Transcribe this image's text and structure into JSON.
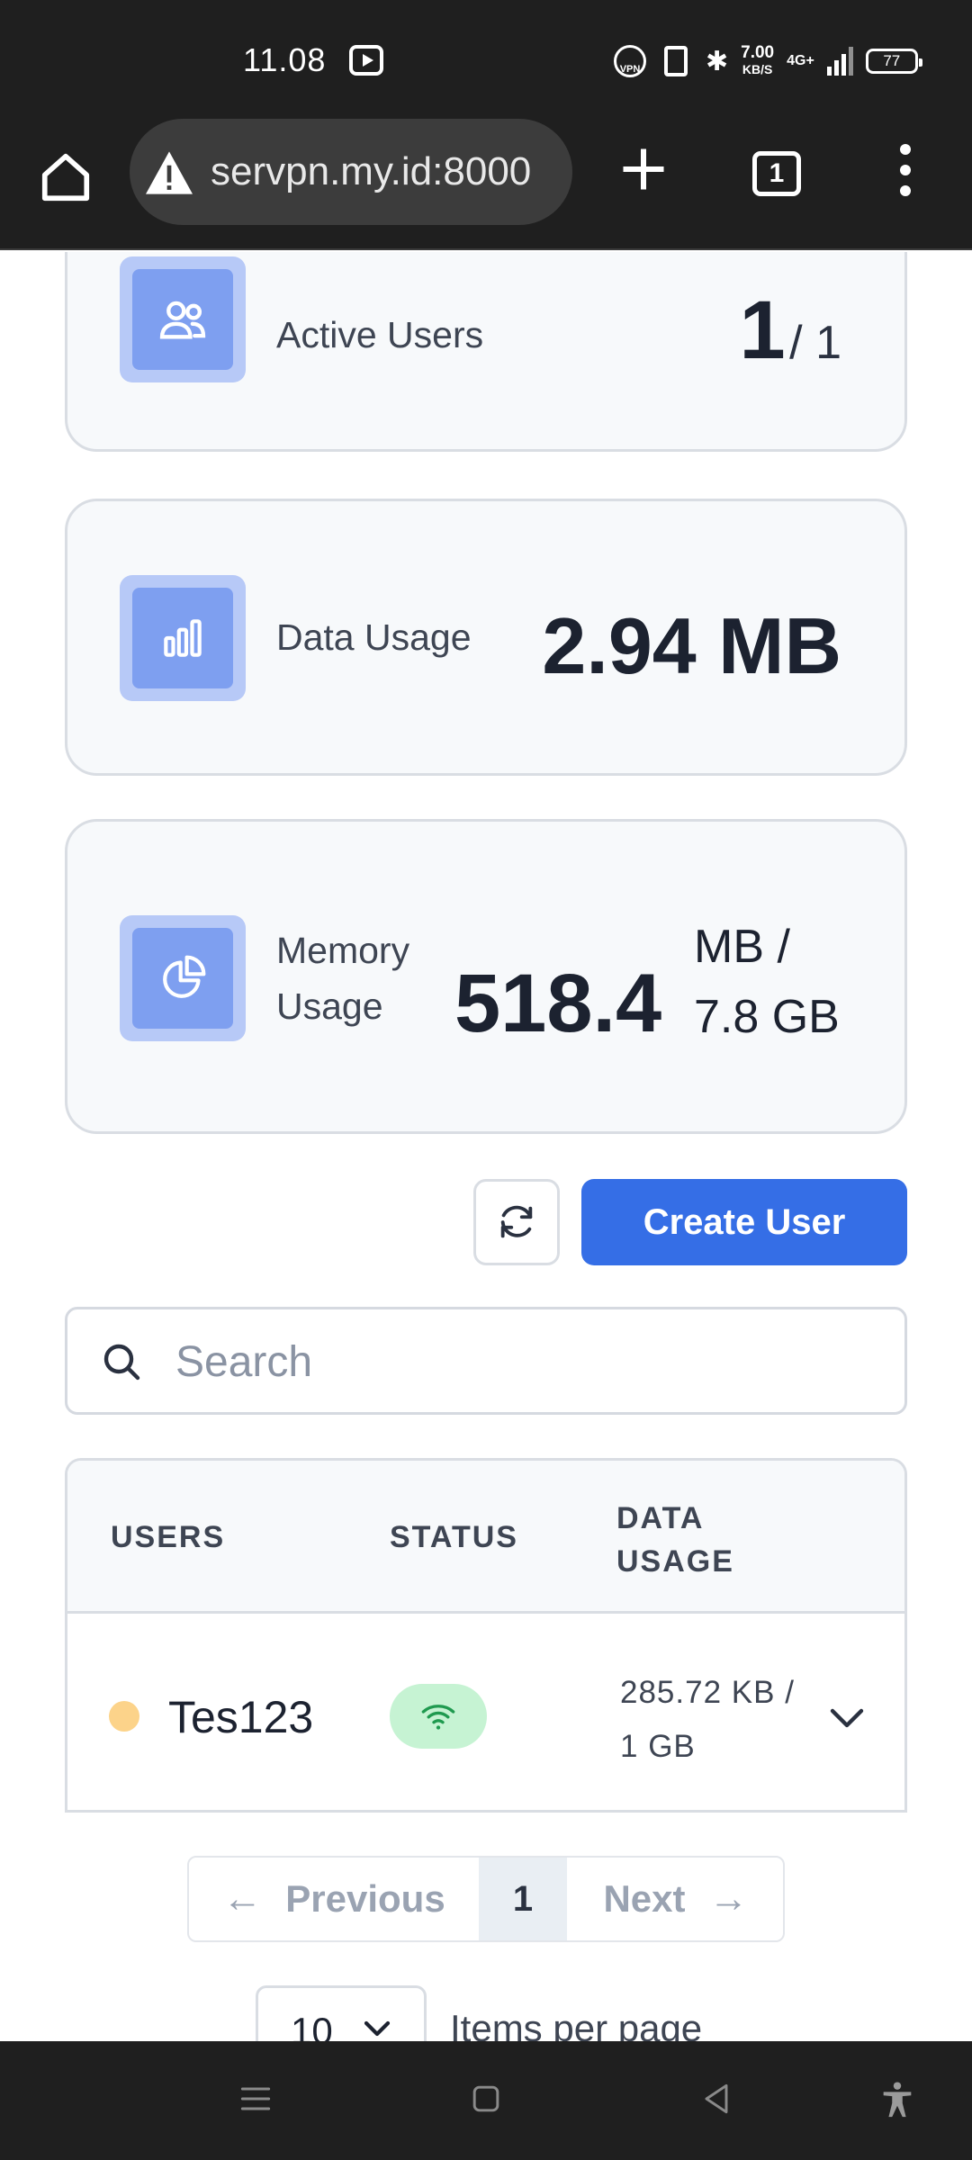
{
  "status_bar": {
    "time": "11.08",
    "vpn_label": "VPN",
    "net_speed_value": "7.00",
    "net_speed_unit": "KB/S",
    "network_type": "4G+",
    "battery": "77"
  },
  "browser": {
    "url": "servpn.my.id:8000",
    "tab_count": "1"
  },
  "stats": {
    "active_users": {
      "label": "Active Users",
      "value": "1",
      "total": "/ 1"
    },
    "data_usage": {
      "label": "Data Usage",
      "value": "2.94 MB"
    },
    "memory_usage": {
      "label_line1": "Memory",
      "label_line2": "Usage",
      "value": "518.4",
      "unit_line1": "MB /",
      "unit_line2": "7.8 GB"
    }
  },
  "actions": {
    "create_user_label": "Create User"
  },
  "search": {
    "placeholder": "Search"
  },
  "table": {
    "headers": {
      "users": "USERS",
      "status": "STATUS",
      "data_usage_line1": "DATA",
      "data_usage_line2": "USAGE"
    },
    "rows": [
      {
        "username": "Tes123",
        "usage_line1": "285.72 KB /",
        "usage_line2": "1 GB"
      }
    ]
  },
  "pagination": {
    "previous_label": "Previous",
    "current_page": "1",
    "next_label": "Next",
    "previous_arrow": "←",
    "next_arrow": "→"
  },
  "per_page": {
    "value": "10",
    "label": "Items per page"
  },
  "colors": {
    "primary": "#356ee6",
    "icon_bg": "#b7c9f7",
    "icon_inner": "#7e9ff0",
    "status_online": "#c6f3d3",
    "user_dot": "#fcd38a"
  }
}
